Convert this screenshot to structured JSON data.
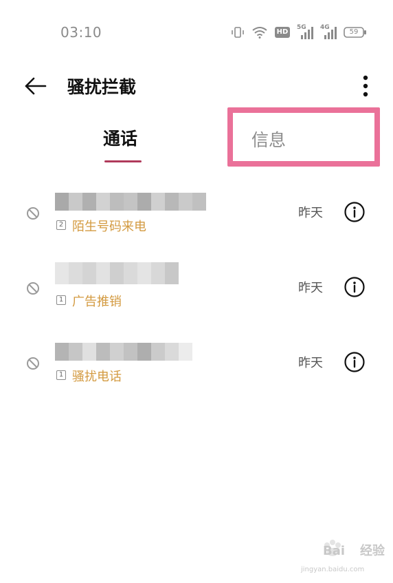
{
  "status_bar": {
    "time": "03:10",
    "network_5g": "5G",
    "network_4g": "4G",
    "hd_badge": "HD",
    "battery": "59"
  },
  "header": {
    "title": "骚扰拦截"
  },
  "tabs": [
    {
      "label": "通话",
      "active": true
    },
    {
      "label": "信息",
      "active": false
    }
  ],
  "calls": [
    {
      "sim": "2",
      "type": "陌生号码来电",
      "time": "昨天"
    },
    {
      "sim": "1",
      "type": "广告推销",
      "time": "昨天"
    },
    {
      "sim": "1",
      "type": "骚扰电话",
      "time": "昨天"
    }
  ],
  "watermark": {
    "brand": "Bai",
    "brand_suffix": "经验",
    "url": "jingyan.baidu.com"
  },
  "colors": {
    "accent": "#b03a5b",
    "highlight": "#ea7199",
    "call_type": "#d39a40"
  }
}
